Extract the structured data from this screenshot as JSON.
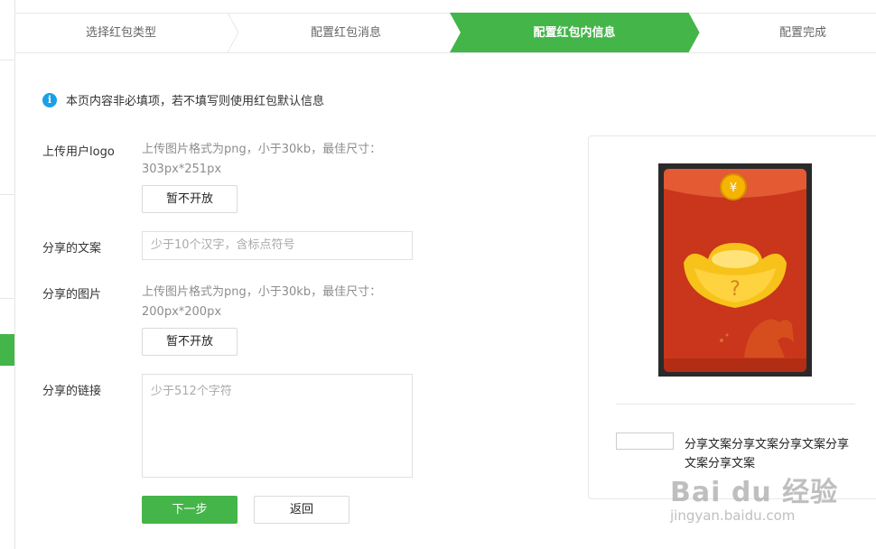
{
  "steps": [
    {
      "label": "选择红包类型",
      "state": "done"
    },
    {
      "label": "配置红包消息",
      "state": "done"
    },
    {
      "label": "配置红包内信息",
      "state": "active"
    },
    {
      "label": "配置完成",
      "state": "pending"
    }
  ],
  "notice": "本页内容非必填项，若不填写则使用红包默认信息",
  "form": {
    "logo": {
      "label": "上传用户logo",
      "hint": "上传图片格式为png，小于30kb，最佳尺寸：303px*251px",
      "button": "暂不开放"
    },
    "share_text": {
      "label": "分享的文案",
      "placeholder": "少于10个汉字，含标点符号"
    },
    "share_image": {
      "label": "分享的图片",
      "hint": "上传图片格式为png，小于30kb，最佳尺寸：200px*200px",
      "button": "暂不开放"
    },
    "share_link": {
      "label": "分享的链接",
      "placeholder": "少于512个字符"
    },
    "next_button": "下一步",
    "back_button": "返回"
  },
  "preview": {
    "share_text": "分享文案分享文案分享文案分享文案分享文案"
  },
  "watermark": {
    "logo": "Bai du 经验",
    "url": "jingyan.baidu.com"
  },
  "colors": {
    "accent": "#44b549",
    "info": "#1aa0e6",
    "envelope": "#c9361b"
  }
}
